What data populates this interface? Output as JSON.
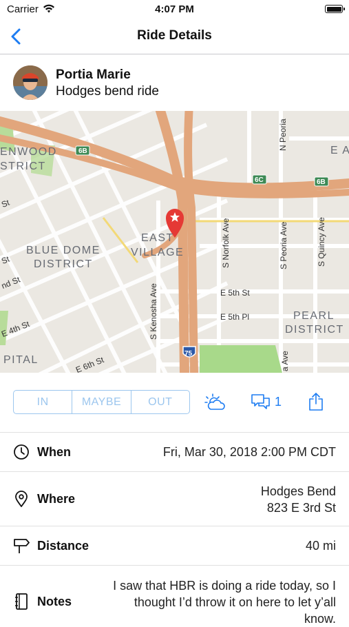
{
  "status": {
    "carrier": "Carrier",
    "time": "4:07 PM"
  },
  "nav": {
    "title": "Ride Details"
  },
  "ride": {
    "rider": "Portia Marie",
    "name": "Hodges bend ride"
  },
  "map": {
    "districts": [
      "ENWOOD",
      "STRICT",
      "BLUE DOME",
      "DISTRICT",
      "EAST",
      "VILLAGE",
      "PEARL",
      "DISTRICT",
      "PITAL",
      "E A"
    ],
    "streets": [
      "S Norfolk Ave",
      "S Peoria Ave",
      "S Quincy Ave",
      "N Peoria",
      "S Kenosha Ave",
      "E 5th St",
      "E 5th Pl",
      "E 4th St",
      "E 6th St",
      "nd St",
      "St",
      "St",
      "a Ave"
    ],
    "shields": [
      "6B",
      "6C",
      "6B",
      "75"
    ]
  },
  "rsvp": {
    "in": "IN",
    "maybe": "MAYBE",
    "out": "OUT"
  },
  "comments": {
    "count": "1"
  },
  "details": {
    "when_label": "When",
    "when_value": "Fri, Mar 30, 2018 2:00 PM CDT",
    "where_label": "Where",
    "where_line1": "Hodges Bend",
    "where_line2": "823 E 3rd St",
    "distance_label": "Distance",
    "distance_value": "40 mi",
    "notes_label": "Notes",
    "notes_line1": "I saw that HBR is doing a ride today, so I",
    "notes_line2": "thought I’d throw it on here to let y’all",
    "notes_line3": "know."
  },
  "colors": {
    "accent": "#1d7cf2",
    "segment": "#9cc6ee",
    "highway": "#e2a67c",
    "pin": "#e53935"
  },
  "icons": [
    "back-chevron-icon",
    "wifi-icon",
    "battery-icon",
    "weather-icon",
    "comments-icon",
    "share-icon",
    "clock-icon",
    "location-pin-icon",
    "signpost-icon",
    "notebook-icon",
    "map-pin-icon"
  ]
}
